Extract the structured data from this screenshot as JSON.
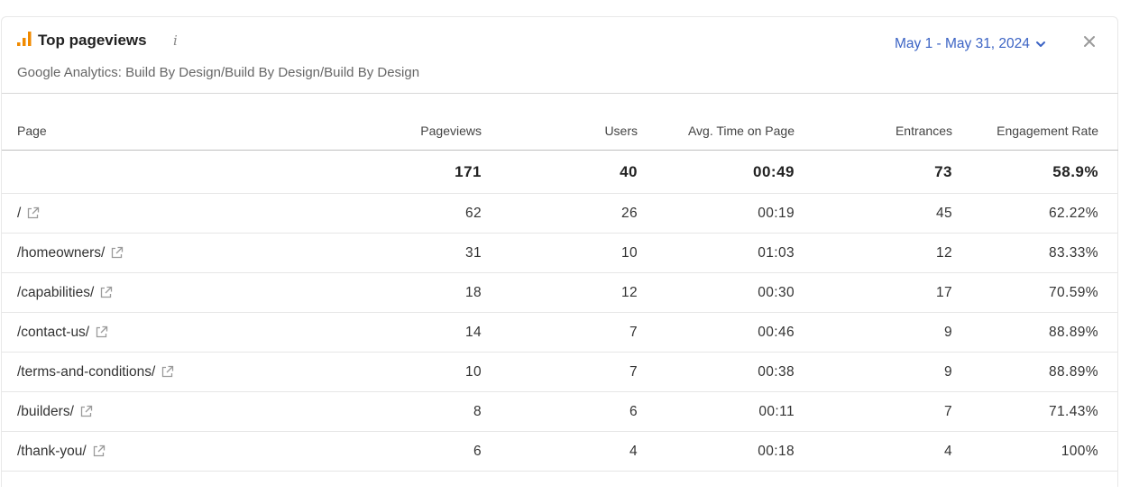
{
  "widget": {
    "title": "Top pageviews",
    "info_icon": "i",
    "subtitle": "Google Analytics: Build By Design/Build By Design/Build By Design",
    "date_range": "May 1 - May 31, 2024",
    "icons": {
      "header": "bar-chart-icon",
      "info": "info-icon",
      "dropdown": "chevron-down-icon",
      "close": "close-icon",
      "row_link": "external-link-icon"
    },
    "colors": {
      "accent": "#3b63c4",
      "chart_icon": "#f08a00"
    }
  },
  "table": {
    "headers": {
      "page": "Page",
      "pageviews": "Pageviews",
      "users": "Users",
      "avg_time": "Avg. Time on Page",
      "entrances": "Entrances",
      "engagement": "Engagement Rate"
    },
    "totals": {
      "pageviews": "171",
      "users": "40",
      "avg_time": "00:49",
      "entrances": "73",
      "engagement": "58.9%"
    },
    "rows": [
      {
        "page": "/",
        "pageviews": "62",
        "users": "26",
        "avg_time": "00:19",
        "entrances": "45",
        "engagement": "62.22%"
      },
      {
        "page": "/homeowners/",
        "pageviews": "31",
        "users": "10",
        "avg_time": "01:03",
        "entrances": "12",
        "engagement": "83.33%"
      },
      {
        "page": "/capabilities/",
        "pageviews": "18",
        "users": "12",
        "avg_time": "00:30",
        "entrances": "17",
        "engagement": "70.59%"
      },
      {
        "page": "/contact-us/",
        "pageviews": "14",
        "users": "7",
        "avg_time": "00:46",
        "entrances": "9",
        "engagement": "88.89%"
      },
      {
        "page": "/terms-and-conditions/",
        "pageviews": "10",
        "users": "7",
        "avg_time": "00:38",
        "entrances": "9",
        "engagement": "88.89%"
      },
      {
        "page": "/builders/",
        "pageviews": "8",
        "users": "6",
        "avg_time": "00:11",
        "entrances": "7",
        "engagement": "71.43%"
      },
      {
        "page": "/thank-you/",
        "pageviews": "6",
        "users": "4",
        "avg_time": "00:18",
        "entrances": "4",
        "engagement": "100%"
      }
    ]
  }
}
